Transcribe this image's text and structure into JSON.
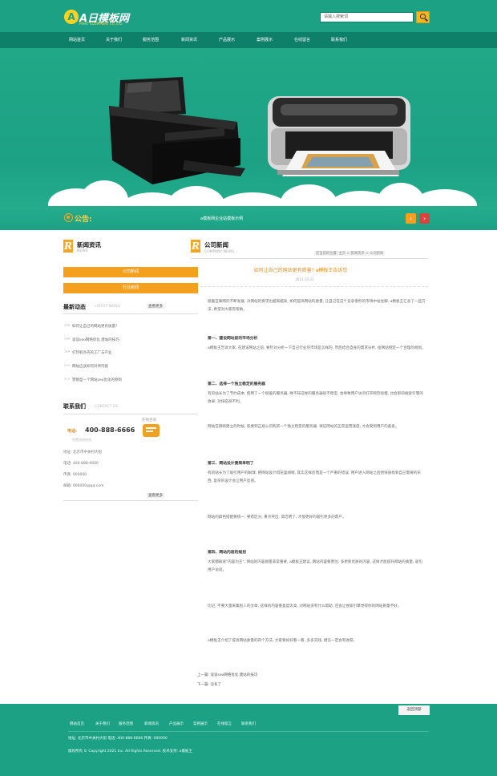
{
  "header": {
    "logo_letter": "A",
    "logo_text": "A日模板网",
    "logo_sub": "PRINT EQUIPMENT CO.,LTD",
    "search_placeholder": "请输入搜索词"
  },
  "nav": {
    "items": [
      "网站首页",
      "关于我们",
      "服务范围",
      "新闻资讯",
      "产品展示",
      "案例展示",
      "在线留言",
      "联系我们"
    ]
  },
  "notice": {
    "label": "公告:",
    "text": "a模板网企业站模板示例"
  },
  "sidebar": {
    "news_title": "新闻资讯",
    "news_sub": "NEWS",
    "buttons": [
      "公司新闻",
      "行业新闻"
    ],
    "latest_title": "最新动态",
    "latest_sub": "LATEST NEWS",
    "latest_more": "查看更多",
    "latest_items": [
      "如何让自己的网站更有质量?",
      "谈谈seo网络优化 建站的技巧",
      "打印机外壳的工厂与产业",
      "网站应该如何对待内链",
      "营销型一个网站seo优化的原则"
    ],
    "contact_title": "联系我们",
    "contact_sub": "CONTACT US",
    "contact_online": "在线咨询",
    "phone_label": "电话:",
    "phone": "400-888-6666",
    "phone_note": "免费咨询热线",
    "contact_lines": [
      "地址: 北京市中关村大街",
      "电话: 400-888-6666",
      "传真: 000000",
      "邮箱: 000000@qq.com"
    ],
    "contact_more": "查看更多"
  },
  "main": {
    "title": "公司新闻",
    "sub": "COMPANY NEWS",
    "breadcrumb": "您当前的位置: 主页 > 新闻资讯 > 公司新闻",
    "article_title": "如何让自己的网站更有质量? a模板王告诉您",
    "article_date": "2021-10-21",
    "paragraphs": [
      "随着互联网的不断发展, 对网站的要求也越来越高, 如何提高网站的质量, 让自己在这个竞争激烈的市场中站住脚, a模板王汇总了一些方法, 希望对大家有帮助。",
      "第一、建设网站前的市场分析",
      "a模板王告诉大家, 在建设网站之前, 要针对分析一下自己行业的市场是怎样的, 然后结合自身的需求分析, 给网站制定一个合理的规划。",
      "第二、选择一个独立稳定的服务器",
      "有的站长为了节约成本, 使用了一个很差的服务器, 殊不知这样的服务器很不稳定, 会导致用户访问打开网页很慢, 也会影响搜索引擎的收录, 对排名很不利。",
      "网站在刚刚建立的时候, 就要到正规公司购买一个独立稳定的服务器, 保证网站的正常运营速度, 才会受到用户的喜爱。",
      "第三、网站设计要简单明了",
      "有的站长为了吸引用户的眼球, 把网站设计得花里胡哨, 其实这样反而是一个严重的错误, 用户进入网站之后想快速找到自己需要的东西, 复杂的设计会让用户反感。",
      "网站的颜色搭配要统一, 要有区分, 重点突出, 简洁明了, 才能更好的吸引更多的客户。",
      "第四、网站内容的规划",
      "大家都知道\"内容为王\", 网站的内容质量非常重要, a模板王建议, 网站内容要原创, 多更新优质的内容, 这样才能提升网站的质量, 吸引用户访问。",
      "切记, 不要大量采集别人的文章, 这样的内容重复度太高, 对网站没有什么帮助, 还会让搜索引擎觉得你的网站质量不好。",
      "a模板王介绍了提高网站质量的四个方法, 大家要好好看一看, 多多实践, 相信一定会有收获。"
    ],
    "prev_label": "上一篇:",
    "prev_text": "谈谈seo网络优化 建站的技巧",
    "next_label": "下一篇:",
    "next_text": "没有了"
  },
  "footer": {
    "back_top": "返回顶部",
    "links": [
      "网站首页",
      "关于我们",
      "服务范围",
      "新闻资讯",
      "产品展示",
      "案例展示",
      "在线留言",
      "联系我们"
    ],
    "line1": "地址: 北京市中关村大街   电话: 400-888-6666   传真: 000000",
    "line2": "版权所有 © Copyright 2021 Inc. All Rights Reserved.   技术支持: a模板王"
  },
  "colors": {
    "brand": "#1ca184",
    "brand_dark": "#0e7f69",
    "accent": "#f4a01f",
    "logo_yellow": "#ffd21f"
  }
}
